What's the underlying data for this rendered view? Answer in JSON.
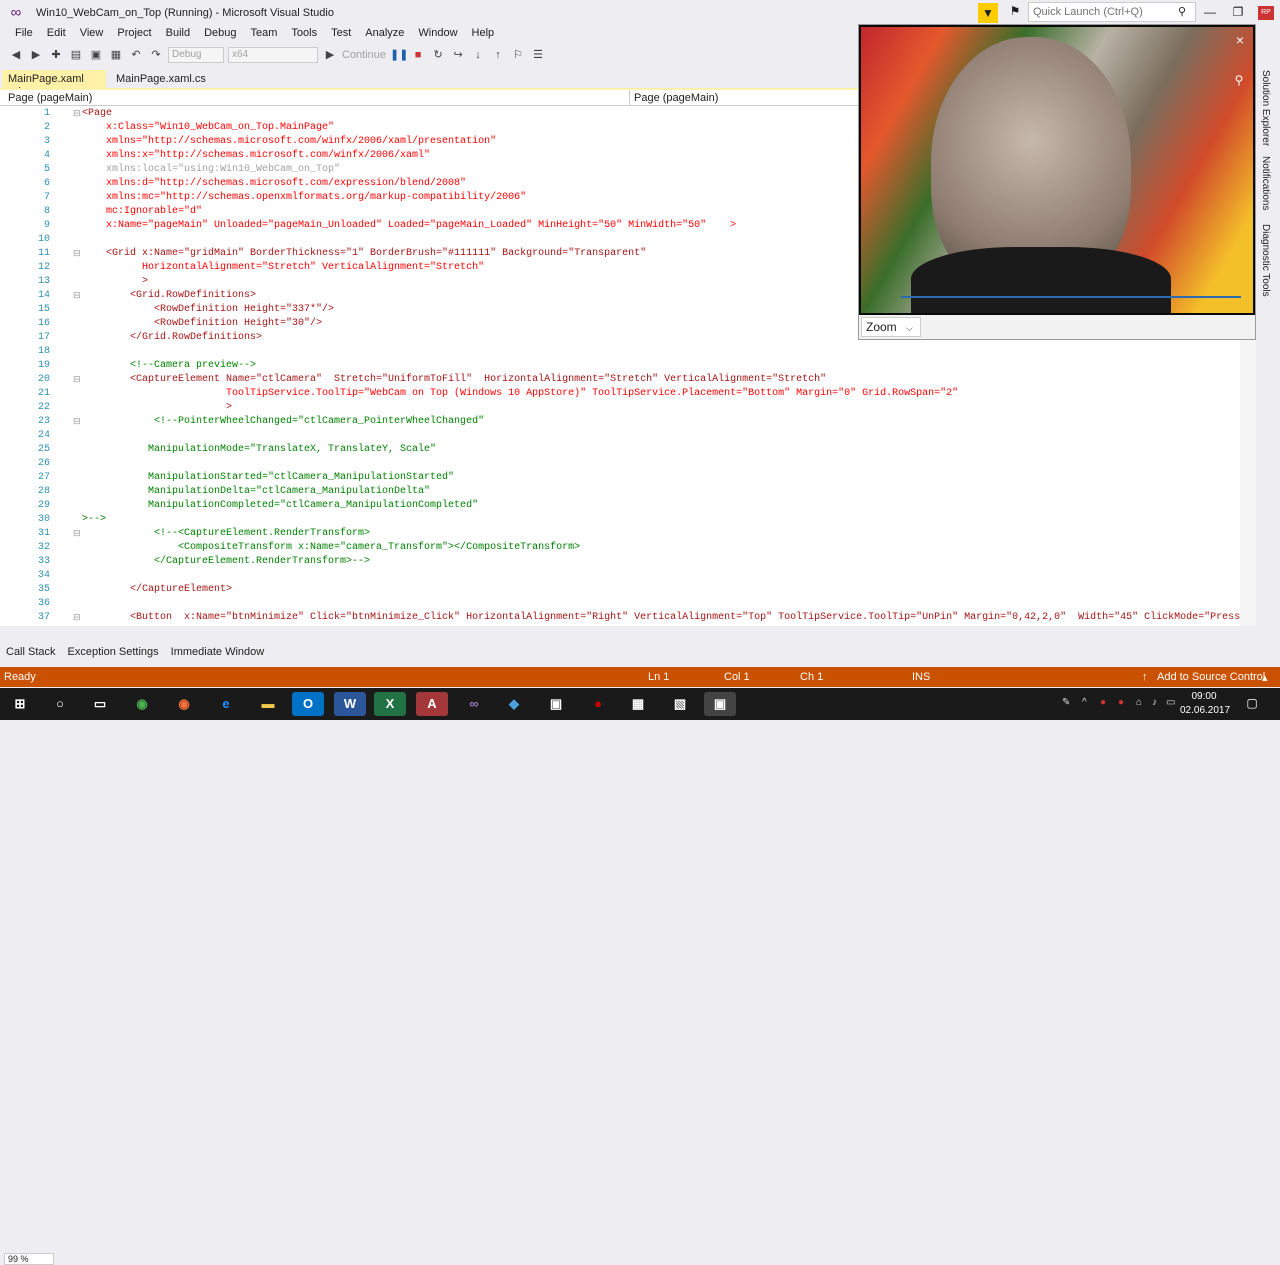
{
  "window": {
    "title": "Win10_WebCam_on_Top (Running) - Microsoft Visual Studio",
    "quick_launch_placeholder": "Quick Launch (Ctrl+Q)",
    "user_initials": "RP"
  },
  "menu": [
    "File",
    "Edit",
    "View",
    "Project",
    "Build",
    "Debug",
    "Team",
    "Tools",
    "Test",
    "Analyze",
    "Window",
    "Help"
  ],
  "toolbar": {
    "config": "Debug",
    "platform": "x64",
    "continue_label": "Continue"
  },
  "tabs": [
    {
      "label": "MainPage.xaml",
      "pin": "⊅ ×"
    },
    {
      "label": "MainPage.xaml.cs"
    }
  ],
  "nav": {
    "left": "Page (pageMain)",
    "right": "Page (pageMain)"
  },
  "editor": {
    "zoom": "99 %",
    "lines": [
      {
        "n": "1",
        "text": "<Page"
      },
      {
        "n": "2",
        "text": "    x:Class=\"Win10_WebCam_on_Top.MainPage\""
      },
      {
        "n": "3",
        "text": "    xmlns=\"http://schemas.microsoft.com/winfx/2006/xaml/presentation\""
      },
      {
        "n": "4",
        "text": "    xmlns:x=\"http://schemas.microsoft.com/winfx/2006/xaml\""
      },
      {
        "n": "5",
        "text": "    xmlns:local=\"using:Win10_WebCam_on_Top\""
      },
      {
        "n": "6",
        "text": "    xmlns:d=\"http://schemas.microsoft.com/expression/blend/2008\""
      },
      {
        "n": "7",
        "text": "    xmlns:mc=\"http://schemas.openxmlformats.org/markup-compatibility/2006\""
      },
      {
        "n": "8",
        "text": "    mc:Ignorable=\"d\""
      },
      {
        "n": "9",
        "text": "    x:Name=\"pageMain\" Unloaded=\"pageMain_Unloaded\" Loaded=\"pageMain_Loaded\" MinHeight=\"50\" MinWidth=\"50\"    >"
      },
      {
        "n": "10",
        "text": ""
      },
      {
        "n": "11",
        "text": "    <Grid x:Name=\"gridMain\" BorderThickness=\"1\" BorderBrush=\"#111111\" Background=\"Transparent\""
      },
      {
        "n": "12",
        "text": "          HorizontalAlignment=\"Stretch\" VerticalAlignment=\"Stretch\""
      },
      {
        "n": "13",
        "text": "          >"
      },
      {
        "n": "14",
        "text": "        <Grid.RowDefinitions>"
      },
      {
        "n": "15",
        "text": "            <RowDefinition Height=\"337*\"/>"
      },
      {
        "n": "16",
        "text": "            <RowDefinition Height=\"30\"/>"
      },
      {
        "n": "17",
        "text": "        </Grid.RowDefinitions>"
      },
      {
        "n": "18",
        "text": ""
      },
      {
        "n": "19",
        "text": "        <!--Camera preview-->"
      },
      {
        "n": "20",
        "text": "        <CaptureElement Name=\"ctlCamera\"  Stretch=\"UniformToFill\"  HorizontalAlignment=\"Stretch\" VerticalAlignment=\"Stretch\""
      },
      {
        "n": "21",
        "text": "                        ToolTipService.ToolTip=\"WebCam on Top (Windows 10 AppStore)\" ToolTipService.Placement=\"Bottom\" Margin=\"0\" Grid.RowSpan=\"2\""
      },
      {
        "n": "22",
        "text": "                        >"
      },
      {
        "n": "23",
        "text": "            <!--PointerWheelChanged=\"ctlCamera_PointerWheelChanged\""
      },
      {
        "n": "24",
        "text": ""
      },
      {
        "n": "25",
        "text": "           ManipulationMode=\"TranslateX, TranslateY, Scale\""
      },
      {
        "n": "26",
        "text": ""
      },
      {
        "n": "27",
        "text": "           ManipulationStarted=\"ctlCamera_ManipulationStarted\""
      },
      {
        "n": "28",
        "text": "           ManipulationDelta=\"ctlCamera_ManipulationDelta\""
      },
      {
        "n": "29",
        "text": "           ManipulationCompleted=\"ctlCamera_ManipulationCompleted\""
      },
      {
        "n": "30",
        "text": ">-->"
      },
      {
        "n": "31",
        "text": "            <!--<CaptureElement.RenderTransform>"
      },
      {
        "n": "32",
        "text": "                <CompositeTransform x:Name=\"camera_Transform\"></CompositeTransform>"
      },
      {
        "n": "33",
        "text": "            </CaptureElement.RenderTransform>-->"
      },
      {
        "n": "34",
        "text": ""
      },
      {
        "n": "35",
        "text": "        </CaptureElement>"
      },
      {
        "n": "36",
        "text": ""
      },
      {
        "n": "37",
        "text": "        <Button  x:Name=\"btnMinimize\" Click=\"btnMinimize_Click\" HorizontalAlignment=\"Right\" VerticalAlignment=\"Top\" ToolTipService.ToolTip=\"UnPin\" Margin=\"0,42,2,0\"  Width=\"45\" ClickMode=\"Press\" "
      }
    ]
  },
  "bottom_tabs": [
    "Call Stack",
    "Exception Settings",
    "Immediate Window"
  ],
  "status": {
    "ready": "Ready",
    "ln": "Ln 1",
    "col": "Col 1",
    "ch": "Ch 1",
    "ins": "INS",
    "source_control": "Add to Source Control"
  },
  "side_tabs": [
    "Solution Explorer",
    "Notifications",
    "Diagnostic Tools"
  ],
  "webcam": {
    "zoom_label": "Zoom"
  },
  "taskbar": {
    "time": "09:00",
    "date": "02.06.2017"
  }
}
